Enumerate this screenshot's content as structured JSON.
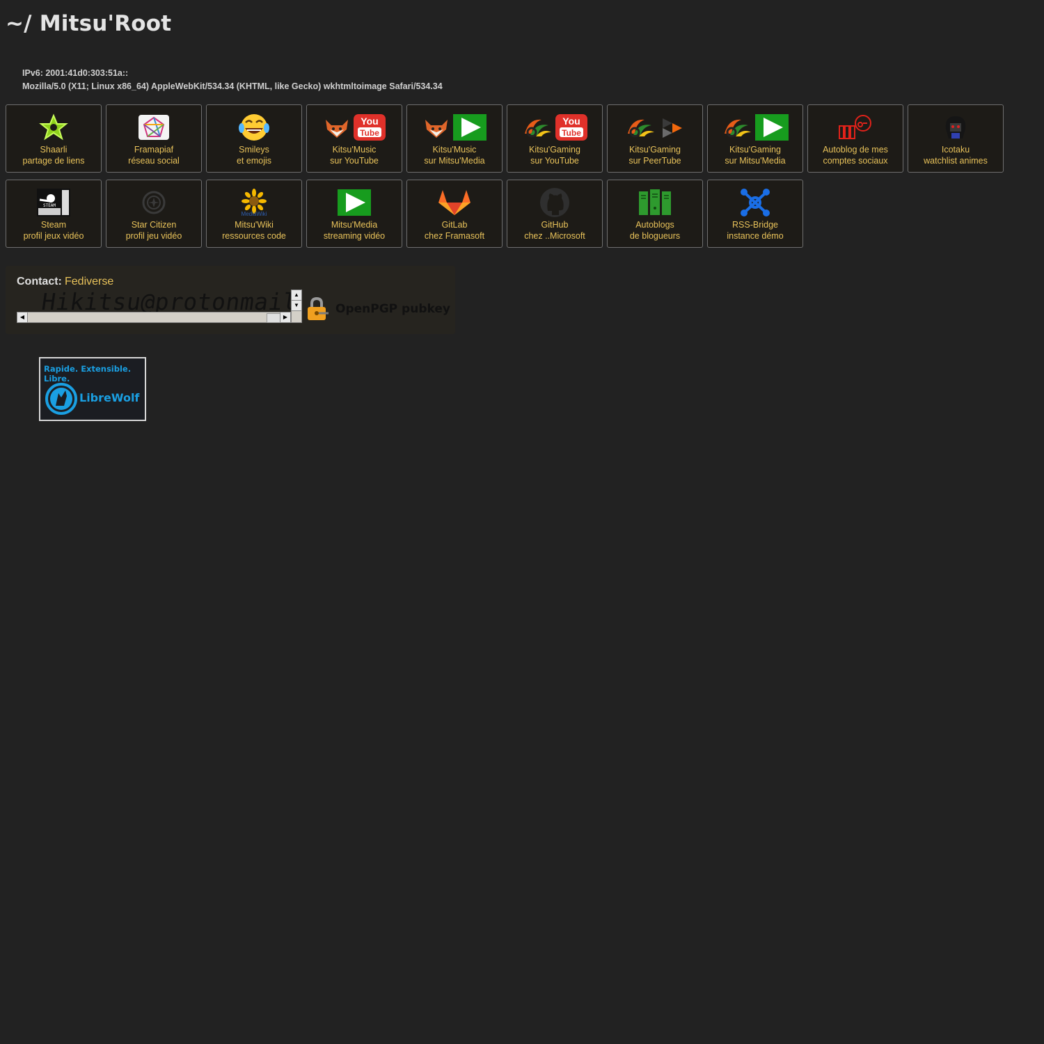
{
  "header": {
    "title": "~/ Mitsu'Root"
  },
  "info": {
    "ipv6": "IPv6: 2001:41d0:303:51a::",
    "useragent": "Mozilla/5.0 (X11; Linux x86_64) AppleWebKit/534.34 (KHTML, like Gecko) wkhtmltoimage Safari/534.34"
  },
  "tiles": [
    {
      "line1": "Shaarli",
      "line2": "partage de liens",
      "icon": "shaarli-star-icon"
    },
    {
      "line1": "Framapiaf",
      "line2": "réseau social",
      "icon": "framapiaf-icon"
    },
    {
      "line1": "Smileys",
      "line2": "et emojis",
      "icon": "laughing-emoji-icon"
    },
    {
      "line1": "Kitsu'Music",
      "line2": "sur YouTube",
      "icon": "fox-youtube-icon"
    },
    {
      "line1": "Kitsu'Music",
      "line2": "sur Mitsu'Media",
      "icon": "fox-play-icon"
    },
    {
      "line1": "Kitsu'Gaming",
      "line2": "sur YouTube",
      "icon": "gaming-youtube-icon"
    },
    {
      "line1": "Kitsu'Gaming",
      "line2": "sur PeerTube",
      "icon": "gaming-peertube-icon"
    },
    {
      "line1": "Kitsu'Gaming",
      "line2": "sur Mitsu'Media",
      "icon": "gaming-play-icon"
    },
    {
      "line1": "Autoblog de mes",
      "line2": "comptes sociaux",
      "icon": "autoblog-icon"
    },
    {
      "line1": "Icotaku",
      "line2": "watchlist animes",
      "icon": "icotaku-icon"
    },
    {
      "line1": "Steam",
      "line2": "profil jeux vidéo",
      "icon": "steam-icon"
    },
    {
      "line1": "Star Citizen",
      "line2": "profil jeu vidéo",
      "icon": "star-citizen-icon"
    },
    {
      "line1": "Mitsu'Wiki",
      "line2": "ressources code",
      "icon": "mediawiki-icon"
    },
    {
      "line1": "Mitsu'Media",
      "line2": "streaming vidéo",
      "icon": "play-icon"
    },
    {
      "line1": "GitLab",
      "line2": "chez Framasoft",
      "icon": "gitlab-icon"
    },
    {
      "line1": "GitHub",
      "line2": "chez ..Microsoft",
      "icon": "github-icon"
    },
    {
      "line1": "Autoblogs",
      "line2": "de blogueurs",
      "icon": "servers-icon"
    },
    {
      "line1": "RSS-Bridge",
      "line2": "instance démo",
      "icon": "rss-bridge-icon"
    }
  ],
  "contact": {
    "label": "Contact:",
    "link": "Fediverse",
    "email": "Hikitsu@protonmail.ch",
    "pgp_label": "OpenPGP pubkey"
  },
  "badge": {
    "tagline": "Rapide. Extensible. Libre.",
    "name": "LibreWolf"
  },
  "colors": {
    "background": "#222222",
    "link": "#e8c25a",
    "tile_border": "#6f6f6f",
    "librewolf_blue": "#1a9fe2"
  }
}
